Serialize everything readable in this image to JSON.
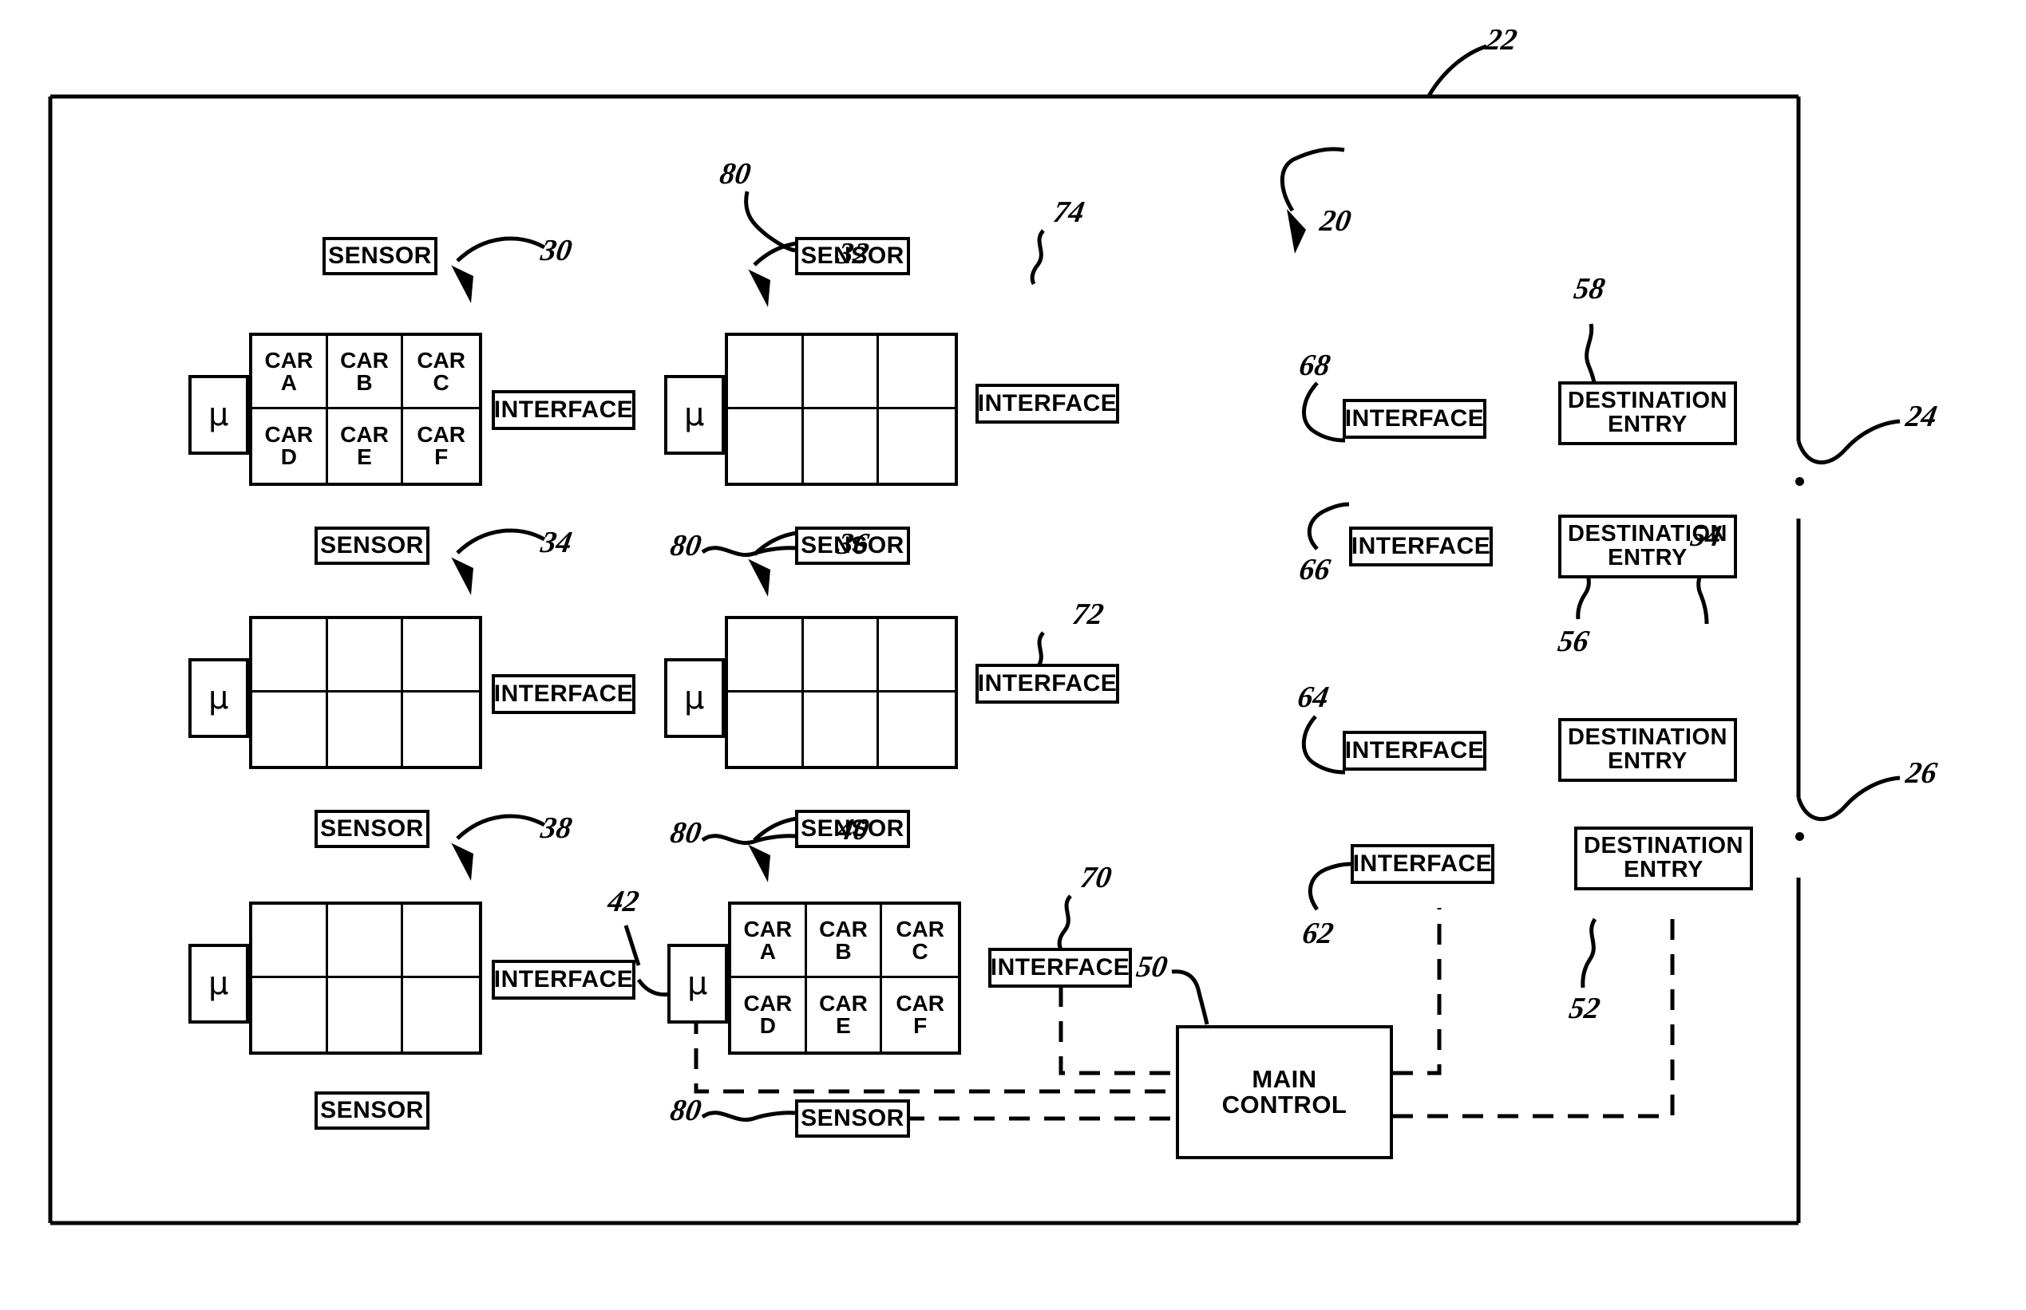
{
  "figure": {
    "building_outline_ref": "22",
    "right_edge_refs": [
      "24",
      "26"
    ],
    "system_ref": "20"
  },
  "labels": {
    "sensor": "SENSOR",
    "interface": "INTERFACE",
    "destination_entry_line1": "DESTINATION",
    "destination_entry_line2": "ENTRY",
    "main_control_line1": "MAIN",
    "main_control_line2": "CONTROL",
    "micro": "µ",
    "car_prefix": "CAR"
  },
  "car_letters": [
    "A",
    "B",
    "C",
    "D",
    "E",
    "F"
  ],
  "groups": [
    {
      "id": "g30",
      "ref": "30",
      "labeled_cars": true,
      "interface_ref": "",
      "sensor_top_ref": "",
      "sensor_bottom_ref": ""
    },
    {
      "id": "g32",
      "ref": "32",
      "labeled_cars": false,
      "interface_ref": "74",
      "sensor_top_ref": "80",
      "sensor_bottom_ref": ""
    },
    {
      "id": "g34",
      "ref": "34",
      "labeled_cars": false,
      "interface_ref": "",
      "sensor_top_ref": "",
      "sensor_bottom_ref": ""
    },
    {
      "id": "g36",
      "ref": "36",
      "labeled_cars": false,
      "interface_ref": "72",
      "sensor_top_ref": "80",
      "sensor_bottom_ref": ""
    },
    {
      "id": "g38",
      "ref": "38",
      "labeled_cars": false,
      "interface_ref": "42",
      "sensor_top_ref": "",
      "sensor_bottom_ref": ""
    },
    {
      "id": "g40",
      "ref": "40",
      "labeled_cars": true,
      "interface_ref": "70",
      "sensor_top_ref": "80",
      "sensor_bottom_ref": "80"
    }
  ],
  "interfaces_column": [
    {
      "ref": "68",
      "text": "INTERFACE"
    },
    {
      "ref": "66",
      "text": "INTERFACE"
    },
    {
      "ref": "64",
      "text": "INTERFACE"
    },
    {
      "ref": "62",
      "text": "INTERFACE"
    }
  ],
  "destination_entries": [
    {
      "ref": "58",
      "text": "DESTINATION ENTRY"
    },
    {
      "ref": "56",
      "text": "DESTINATION ENTRY"
    },
    {
      "ref": "54",
      "text": "DESTINATION ENTRY"
    },
    {
      "ref": "52",
      "text": "DESTINATION ENTRY"
    }
  ],
  "main_control": {
    "ref": "50",
    "text": "MAIN CONTROL"
  },
  "ref_numbers": {
    "n20": "20",
    "n22": "22",
    "n24": "24",
    "n26": "26",
    "n30": "30",
    "n32": "32",
    "n34": "34",
    "n36": "36",
    "n38": "38",
    "n40": "40",
    "n42": "42",
    "n50": "50",
    "n52": "52",
    "n54": "54",
    "n56": "56",
    "n58": "58",
    "n62": "62",
    "n64": "64",
    "n66": "66",
    "n68": "68",
    "n70": "70",
    "n72": "72",
    "n74": "74",
    "n80a": "80",
    "n80b": "80",
    "n80c": "80",
    "n80d": "80"
  },
  "colors": {
    "ink": "#000000",
    "paper": "#ffffff"
  }
}
